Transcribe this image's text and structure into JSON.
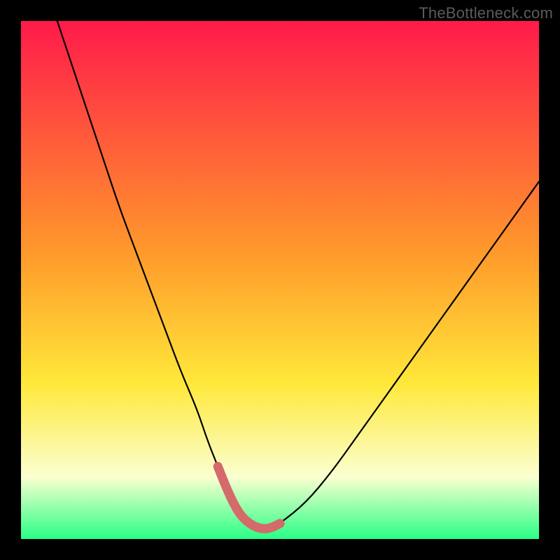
{
  "watermark": "TheBottleneck.com",
  "colors": {
    "bg": "#000000",
    "curve": "#000000",
    "highlight": "#d46a6a",
    "grad_top": "#ff1a4a",
    "grad_orange": "#ff9a2b",
    "grad_yellow": "#ffe83a",
    "grad_pale": "#fbffd0",
    "grad_green": "#29ff86"
  },
  "chart_data": {
    "type": "line",
    "title": "",
    "xlabel": "",
    "ylabel": "",
    "xlim": [
      0,
      100
    ],
    "ylim": [
      0,
      100
    ],
    "series": [
      {
        "name": "bottleneck-curve",
        "x": [
          7,
          10,
          13,
          16,
          19,
          22,
          25,
          28,
          31,
          34,
          36,
          38,
          40,
          42,
          44,
          46,
          48,
          50,
          55,
          60,
          65,
          70,
          75,
          80,
          85,
          90,
          95,
          100
        ],
        "y": [
          100,
          91,
          82,
          73,
          64,
          56,
          48,
          40,
          32,
          25,
          19,
          14,
          9,
          5,
          3,
          2,
          2,
          3,
          7,
          13,
          20,
          27,
          34,
          41,
          48,
          55,
          62,
          69
        ]
      }
    ],
    "highlight": {
      "name": "optimum-region",
      "x": [
        38,
        40,
        42,
        44,
        46,
        48,
        50
      ],
      "y": [
        14,
        9,
        5,
        3,
        2,
        2,
        3
      ]
    },
    "gradient_stops": [
      {
        "offset": 0.0,
        "color": "#ff1a4a"
      },
      {
        "offset": 0.45,
        "color": "#ff9a2b"
      },
      {
        "offset": 0.7,
        "color": "#ffe83a"
      },
      {
        "offset": 0.88,
        "color": "#fbffd0"
      },
      {
        "offset": 1.0,
        "color": "#29ff86"
      }
    ]
  }
}
